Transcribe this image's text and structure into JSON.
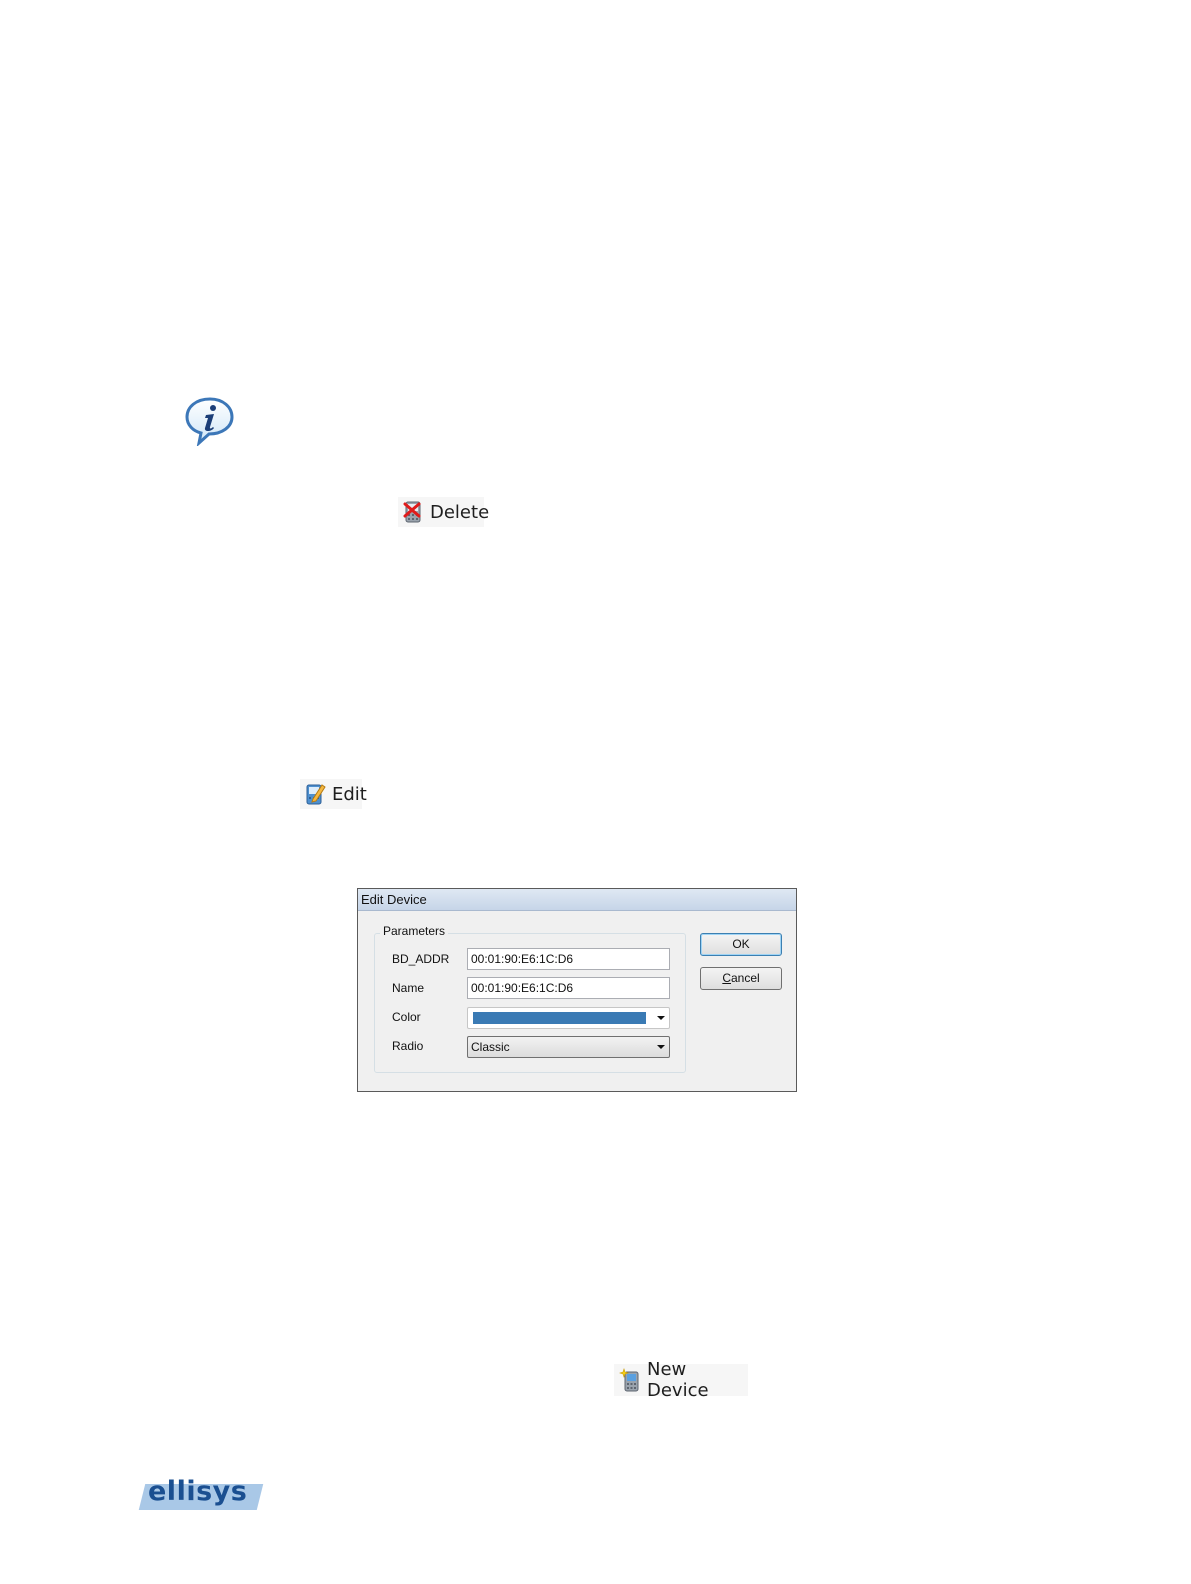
{
  "toolbar_buttons": {
    "delete_label": "Delete",
    "edit_label": "Edit",
    "new_device_label": "New Device"
  },
  "dialog": {
    "title": "Edit Device",
    "group_label": "Parameters",
    "fields": {
      "bd_addr_label": "BD_ADDR",
      "bd_addr_value": "00:01:90:E6:1C:D6",
      "name_label": "Name",
      "name_value": "00:01:90:E6:1C:D6",
      "color_label": "Color",
      "color_value": "#3a7ab4",
      "radio_label": "Radio",
      "radio_value": "Classic"
    },
    "ok_label": "OK",
    "cancel_label_first": "C",
    "cancel_label_rest": "ancel"
  },
  "logo": {
    "text": "ellisys"
  },
  "icons": {
    "info": "info-speech-bubble-icon",
    "delete": "delete-device-icon",
    "edit": "edit-device-icon",
    "new_device": "new-device-icon"
  }
}
